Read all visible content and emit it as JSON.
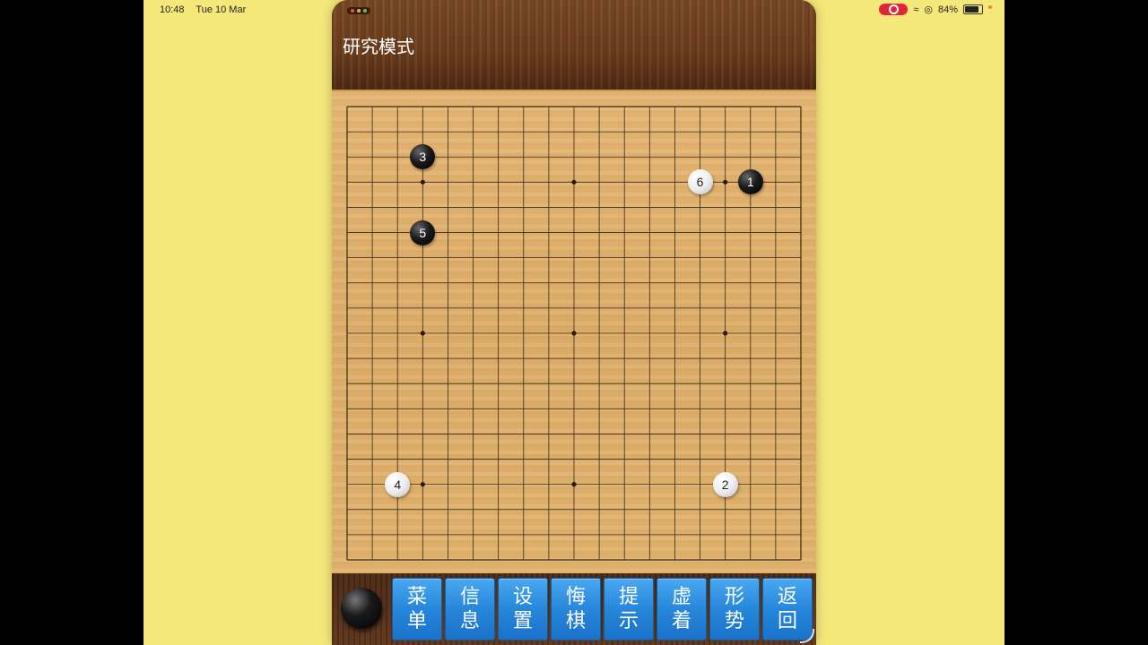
{
  "status_bar": {
    "time": "10:48",
    "date": "Tue 10 Mar",
    "battery": "84%"
  },
  "app": {
    "title": "研究模式"
  },
  "board": {
    "size": 19,
    "star_points": [
      [
        3,
        3
      ],
      [
        9,
        3
      ],
      [
        15,
        3
      ],
      [
        3,
        9
      ],
      [
        9,
        9
      ],
      [
        15,
        9
      ],
      [
        3,
        15
      ],
      [
        9,
        15
      ],
      [
        15,
        15
      ]
    ],
    "stones": [
      {
        "move": "1",
        "color": "black",
        "col": 16,
        "row": 3
      },
      {
        "move": "2",
        "color": "white",
        "col": 15,
        "row": 15
      },
      {
        "move": "3",
        "color": "black",
        "col": 3,
        "row": 2
      },
      {
        "move": "4",
        "color": "white",
        "col": 2,
        "row": 15
      },
      {
        "move": "5",
        "color": "black",
        "col": 3,
        "row": 5
      },
      {
        "move": "6",
        "color": "white",
        "col": 14,
        "row": 3
      }
    ]
  },
  "toolbar": {
    "current_turn": "black",
    "buttons": [
      {
        "top": "菜",
        "bottom": "单"
      },
      {
        "top": "信",
        "bottom": "息"
      },
      {
        "top": "设",
        "bottom": "置"
      },
      {
        "top": "悔",
        "bottom": "棋"
      },
      {
        "top": "提",
        "bottom": "示"
      },
      {
        "top": "虚",
        "bottom": "着"
      },
      {
        "top": "形",
        "bottom": "势"
      },
      {
        "top": "返",
        "bottom": "回"
      }
    ]
  },
  "colors": {
    "screen_bg": "#f5e87a",
    "board_wood": "#e2b46f",
    "frame_wood": "#6b3c1c",
    "button_blue": "#2687db"
  }
}
